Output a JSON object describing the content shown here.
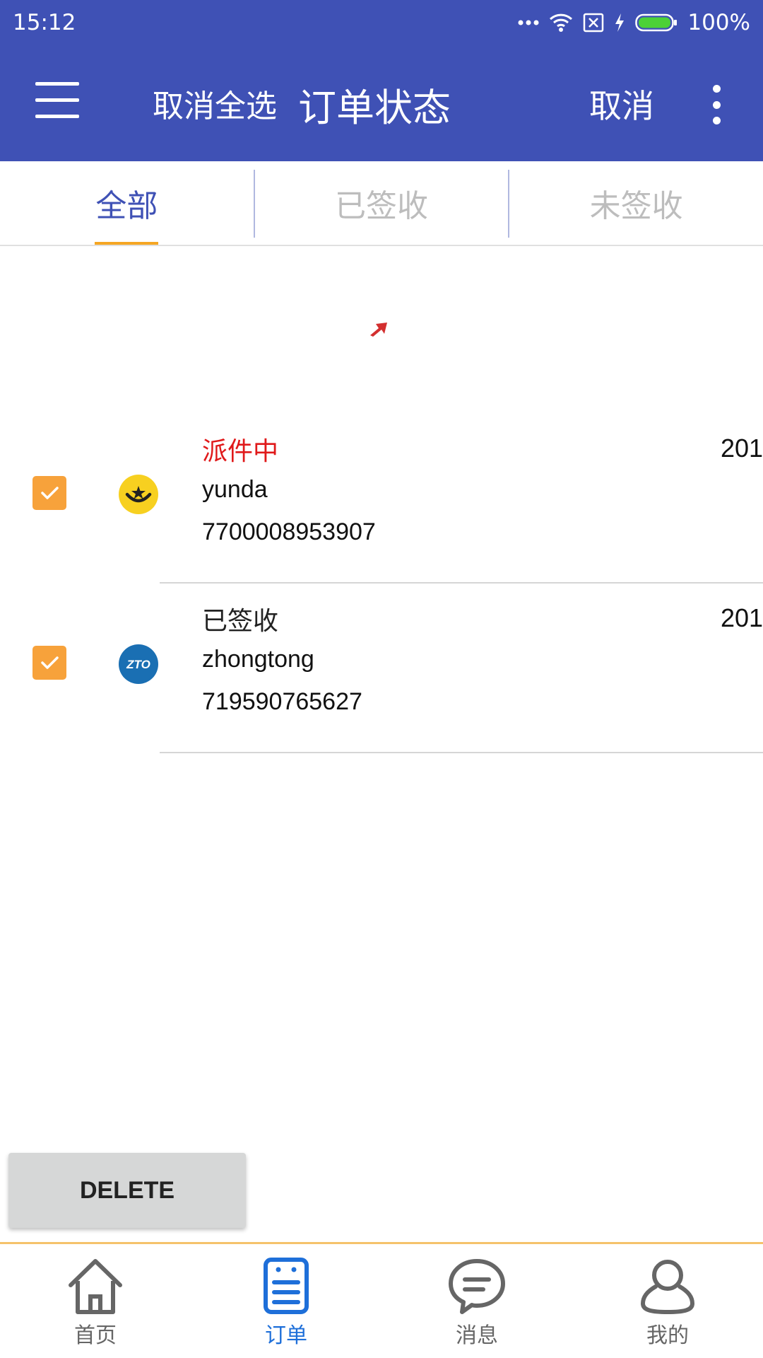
{
  "status_bar": {
    "time": "15:12",
    "battery_percent": "100%",
    "icons": [
      "more-dots-icon",
      "wifi-icon",
      "sim-x-icon",
      "charging-icon",
      "battery-icon"
    ]
  },
  "toolbar": {
    "select_all_label": "取消全选",
    "title": "订单状态",
    "cancel_label": "取消",
    "menu_icon": "hamburger-menu-icon",
    "overflow_icon": "more-vert-icon"
  },
  "tabs": [
    {
      "label": "全部",
      "active": true
    },
    {
      "label": "已签收",
      "active": false
    },
    {
      "label": "未签收",
      "active": false
    }
  ],
  "orders": [
    {
      "status": "派件中",
      "company": "yunda",
      "number": "7700008953907",
      "date": "201",
      "checked": true,
      "logo": "yunda-logo-icon"
    },
    {
      "status": "已签收",
      "company": "zhongtong",
      "number": "719590765627",
      "date": "201",
      "checked": true,
      "logo": "zto-logo-icon",
      "logo_text": "ZTO"
    }
  ],
  "actions": {
    "delete_label": "DELETE"
  },
  "bottom_nav": [
    {
      "label": "首页",
      "icon": "home-icon",
      "active": false
    },
    {
      "label": "订单",
      "icon": "orders-icon",
      "active": true
    },
    {
      "label": "消息",
      "icon": "message-icon",
      "active": false
    },
    {
      "label": "我的",
      "icon": "profile-icon",
      "active": false
    }
  ],
  "colors": {
    "app_bar": "#3f51b5",
    "tab_active": "#3f51b5",
    "tab_indicator": "#f5a623",
    "checkbox": "#f7a23b",
    "status_in_delivery": "#e0191a",
    "nav_active": "#1e6fd9"
  }
}
